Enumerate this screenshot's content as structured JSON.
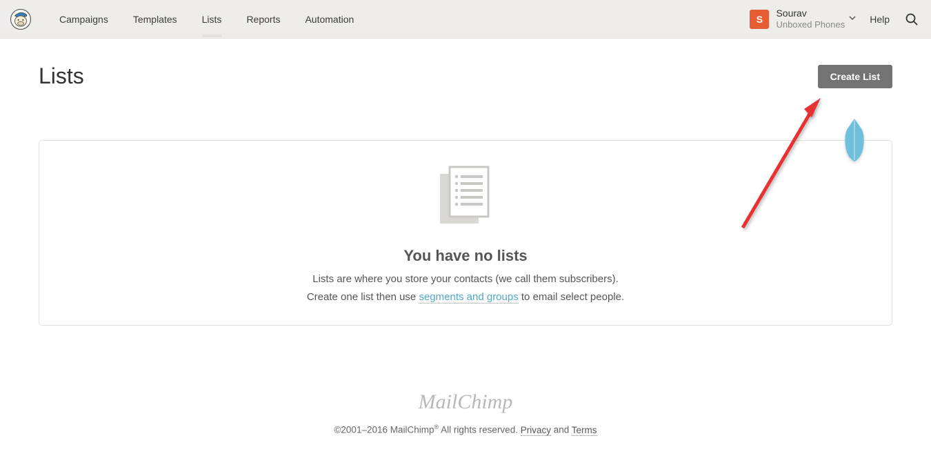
{
  "nav": {
    "campaigns": "Campaigns",
    "templates": "Templates",
    "lists": "Lists",
    "reports": "Reports",
    "automation": "Automation"
  },
  "user": {
    "avatarLetter": "S",
    "name": "Sourav",
    "org": "Unboxed Phones"
  },
  "help": "Help",
  "page": {
    "title": "Lists",
    "create": "Create List",
    "emptyTitle": "You have no lists",
    "line1": "Lists are where you store your contacts (we call them subscribers).",
    "line2a": "Create one list then use ",
    "line2link": "segments and groups",
    "line2b": " to email select people."
  },
  "footer": {
    "brand": "MailChimp",
    "copyA": "©2001–2016 MailChimp",
    "copyB": " All rights reserved. ",
    "privacy": "Privacy",
    "and": " and ",
    "terms": "Terms"
  }
}
